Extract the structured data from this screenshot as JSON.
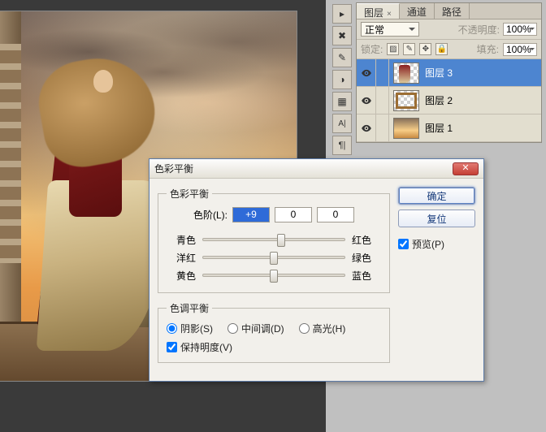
{
  "panel": {
    "tabs": {
      "layers": "图层",
      "channels": "通道",
      "paths": "路径"
    },
    "blend_mode": {
      "value": "正常"
    },
    "opacity": {
      "label": "不透明度:",
      "value": "100%"
    },
    "lock": {
      "label": "锁定:"
    },
    "fill": {
      "label": "填充:",
      "value": "100%"
    },
    "layers": [
      {
        "name": "图层 3"
      },
      {
        "name": "图层 2"
      },
      {
        "name": "图层 1"
      }
    ]
  },
  "dialog": {
    "title": "色彩平衡",
    "group_balance": {
      "legend": "色彩平衡",
      "level_label": "色阶(L):",
      "values": [
        "+9",
        "0",
        "0"
      ],
      "pairs": [
        {
          "left": "青色",
          "right": "红色",
          "pos": 55
        },
        {
          "left": "洋红",
          "right": "绿色",
          "pos": 50
        },
        {
          "left": "黄色",
          "right": "蓝色",
          "pos": 50
        }
      ]
    },
    "group_tone": {
      "legend": "色调平衡",
      "shadows": "阴影(S)",
      "midtones": "中间调(D)",
      "highlights": "高光(H)",
      "preserve": "保持明度(V)"
    },
    "buttons": {
      "ok": "确定",
      "cancel": "复位"
    },
    "preview": "预览(P)"
  }
}
